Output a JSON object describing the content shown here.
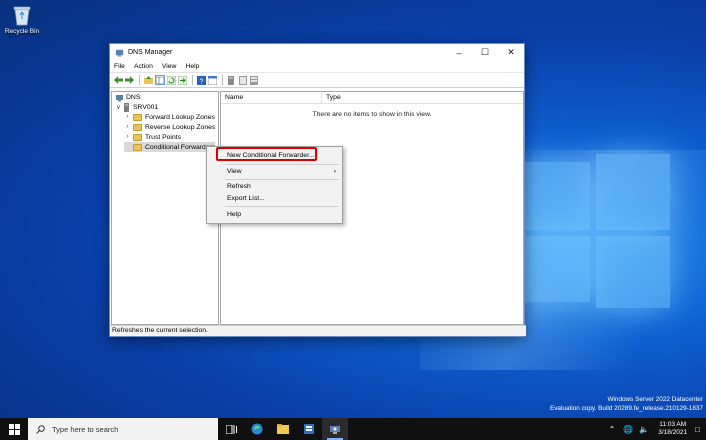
{
  "desktop": {
    "recycle_bin_label": "Recycle Bin"
  },
  "window": {
    "title": "DNS Manager",
    "menu": [
      "File",
      "Action",
      "View",
      "Help"
    ],
    "tree": {
      "root": "DNS",
      "server": "SRV001",
      "nodes": [
        "Forward Lookup Zones",
        "Reverse Lookup Zones",
        "Trust Points",
        "Conditional Forwarders"
      ]
    },
    "columns": [
      "Name",
      "Type"
    ],
    "empty_message": "There are no items to show in this view.",
    "status": "Refreshes the current selection."
  },
  "context_menu": {
    "items": [
      "New Conditional Forwarder...",
      "View",
      "Refresh",
      "Export List...",
      "Help"
    ]
  },
  "watermark": {
    "line1": "Windows Server 2022 Datacenter",
    "line2": "Evaluation copy. Build 20289.fe_release.210129-1837"
  },
  "taskbar": {
    "search_placeholder": "Type here to search",
    "time": "11:03 AM",
    "date": "3/18/2021"
  },
  "colors": {
    "highlight": "#e00000",
    "taskbar": "#101010",
    "accent": "#0e5fd0"
  }
}
